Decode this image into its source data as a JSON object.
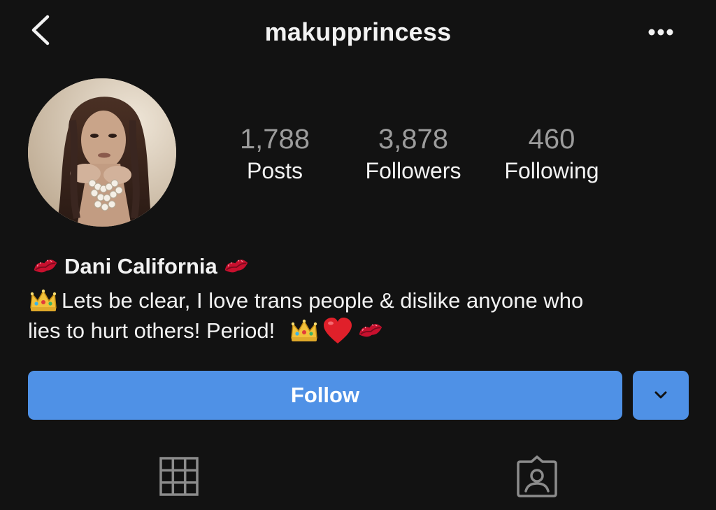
{
  "header": {
    "username": "makupprincess",
    "back_icon": "chevron-left-icon",
    "more_icon": "more-horizontal-icon"
  },
  "profile": {
    "avatar_icon": "profile-photo",
    "stats": {
      "posts": {
        "count": "1,788",
        "label": "Posts"
      },
      "followers": {
        "count": "3,878",
        "label": "Followers"
      },
      "following": {
        "count": "460",
        "label": "Following"
      }
    },
    "name": "Dani California",
    "bio": {
      "line1": "Lets be clear, I love trans people & dislike anyone who",
      "line2": "lies to hurt others! Period!"
    },
    "emoji": {
      "kiss_mark": "kiss-mark-icon",
      "crown": "crown-icon",
      "heart": "red-heart-icon"
    }
  },
  "actions": {
    "follow_label": "Follow",
    "dropdown_icon": "chevron-down-icon"
  },
  "tabs": [
    {
      "icon": "grid-icon"
    },
    {
      "icon": "tagged-photos-icon"
    }
  ],
  "colors": {
    "background": "#121212",
    "accent": "#4f91e6",
    "muted_text": "#9c9c9c"
  }
}
